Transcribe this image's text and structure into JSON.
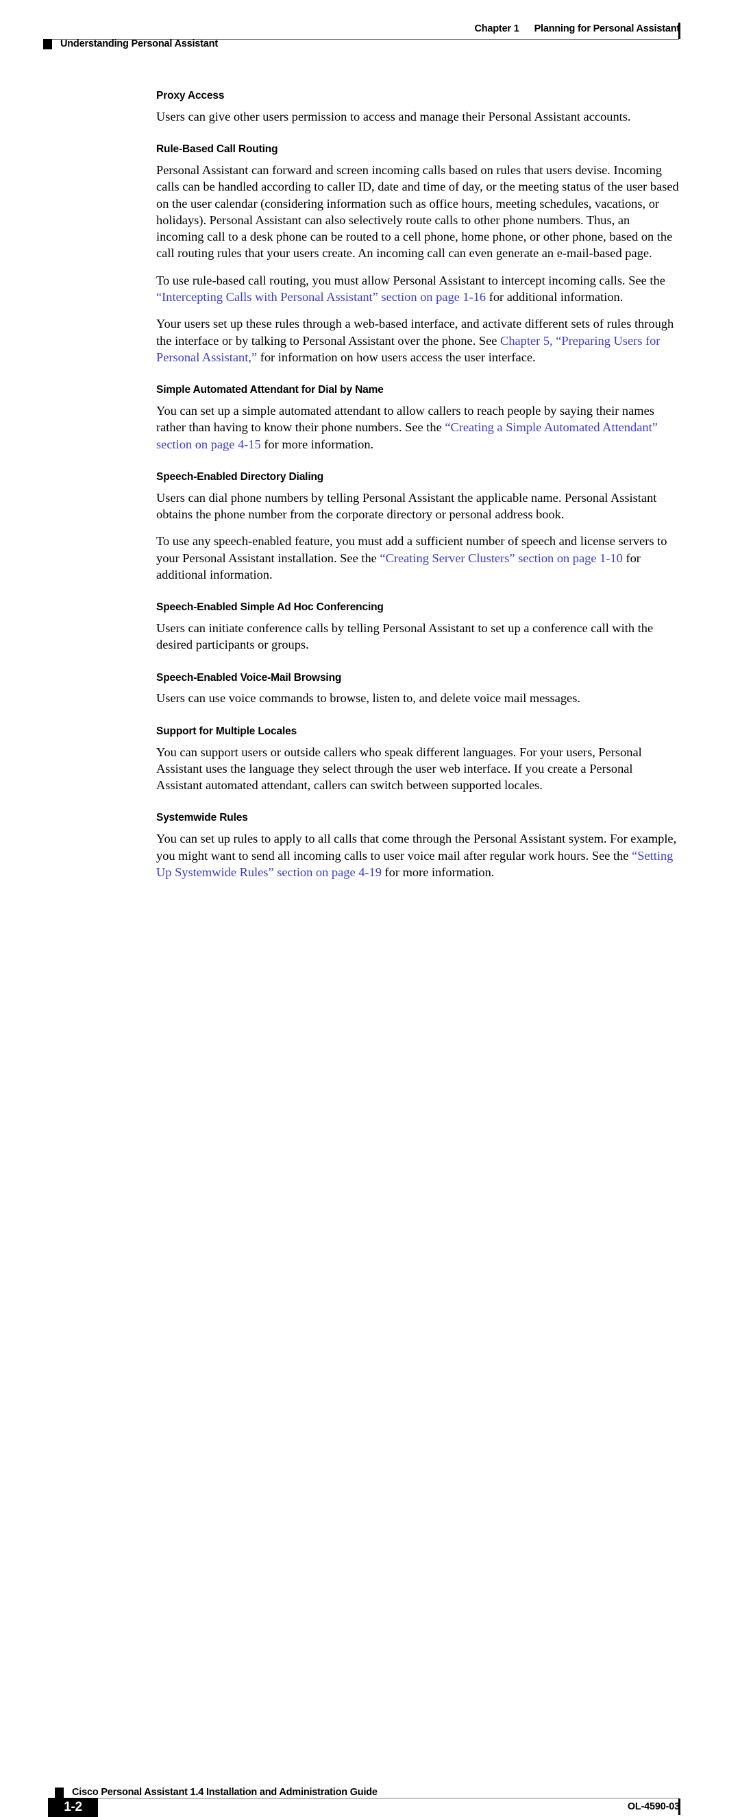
{
  "header": {
    "chapter_number": "Chapter 1",
    "chapter_title": "Planning for Personal Assistant",
    "section_label": "Understanding Personal Assistant"
  },
  "footer": {
    "page_number": "1-2",
    "guide_title": "Cisco Personal Assistant 1.4 Installation and Administration Guide",
    "doc_id": "OL-4590-03"
  },
  "colors": {
    "link": "#3a3ad6",
    "text": "#000000",
    "rule": "#7a7a7a",
    "page_background": "#ffffff"
  },
  "sections": [
    {
      "heading": "Proxy Access",
      "paragraphs": [
        {
          "runs": [
            {
              "text": "Users can give other users permission to access and manage their Personal Assistant accounts.",
              "link": false
            }
          ]
        }
      ]
    },
    {
      "heading": "Rule-Based Call Routing",
      "paragraphs": [
        {
          "runs": [
            {
              "text": "Personal Assistant can forward and screen incoming calls based on rules that users devise. Incoming calls can be handled according to caller ID, date and time of day, or the meeting status of the user based on the user calendar (considering information such as office hours, meeting schedules, vacations, or holidays). Personal Assistant can also selectively route calls to other phone numbers. Thus, an incoming call to a desk phone can be routed to a cell phone, home phone, or other phone, based on the call routing rules that your users create. An incoming call can even generate an e-mail-based page.",
              "link": false
            }
          ]
        },
        {
          "runs": [
            {
              "text": "To use rule-based call routing, you must allow Personal Assistant to intercept incoming calls. See the ",
              "link": false
            },
            {
              "text": "“Intercepting Calls with Personal Assistant” section on page 1-16",
              "link": true
            },
            {
              "text": " for additional information.",
              "link": false
            }
          ]
        },
        {
          "runs": [
            {
              "text": "Your users set up these rules through a web-based interface, and activate different sets of rules through the interface or by talking to Personal Assistant over the phone. See ",
              "link": false
            },
            {
              "text": "Chapter 5, “Preparing Users for Personal Assistant,”",
              "link": true
            },
            {
              "text": " for information on how users access the user interface.",
              "link": false
            }
          ]
        }
      ]
    },
    {
      "heading": "Simple Automated Attendant for Dial by Name",
      "paragraphs": [
        {
          "runs": [
            {
              "text": "You can set up a simple automated attendant to allow callers to reach people by saying their names rather than having to know their phone numbers. See the ",
              "link": false
            },
            {
              "text": "“Creating a Simple Automated Attendant” section on page 4-15",
              "link": true
            },
            {
              "text": " for more information.",
              "link": false
            }
          ]
        }
      ]
    },
    {
      "heading": "Speech-Enabled Directory Dialing",
      "paragraphs": [
        {
          "runs": [
            {
              "text": "Users can dial phone numbers by telling Personal Assistant the applicable name. Personal Assistant obtains the phone number from the corporate directory or personal address book.",
              "link": false
            }
          ]
        },
        {
          "runs": [
            {
              "text": "To use any speech-enabled feature, you must add a sufficient number of speech and license servers to your Personal Assistant installation. See the ",
              "link": false
            },
            {
              "text": "“Creating Server Clusters” section on page 1-10",
              "link": true
            },
            {
              "text": " for additional information.",
              "link": false
            }
          ]
        }
      ]
    },
    {
      "heading": "Speech-Enabled Simple Ad Hoc Conferencing",
      "paragraphs": [
        {
          "runs": [
            {
              "text": "Users can initiate conference calls by telling Personal Assistant to set up a conference call with the desired participants or groups.",
              "link": false
            }
          ]
        }
      ]
    },
    {
      "heading": "Speech-Enabled Voice-Mail Browsing",
      "paragraphs": [
        {
          "runs": [
            {
              "text": "Users can use voice commands to browse, listen to, and delete voice mail messages.",
              "link": false
            }
          ]
        }
      ]
    },
    {
      "heading": "Support for Multiple Locales",
      "paragraphs": [
        {
          "runs": [
            {
              "text": "You can support users or outside callers who speak different languages. For your users, Personal Assistant uses the language they select through the user web interface. If you create a Personal Assistant automated attendant, callers can switch between supported locales.",
              "link": false
            }
          ]
        }
      ]
    },
    {
      "heading": "Systemwide Rules",
      "paragraphs": [
        {
          "runs": [
            {
              "text": "You can set up rules to apply to all calls that come through the Personal Assistant system. For example, you might want to send all incoming calls to user voice mail after regular work hours. See the ",
              "link": false
            },
            {
              "text": "“Setting Up Systemwide Rules” section on page 4-19",
              "link": true
            },
            {
              "text": " for more information.",
              "link": false
            }
          ]
        }
      ]
    }
  ]
}
